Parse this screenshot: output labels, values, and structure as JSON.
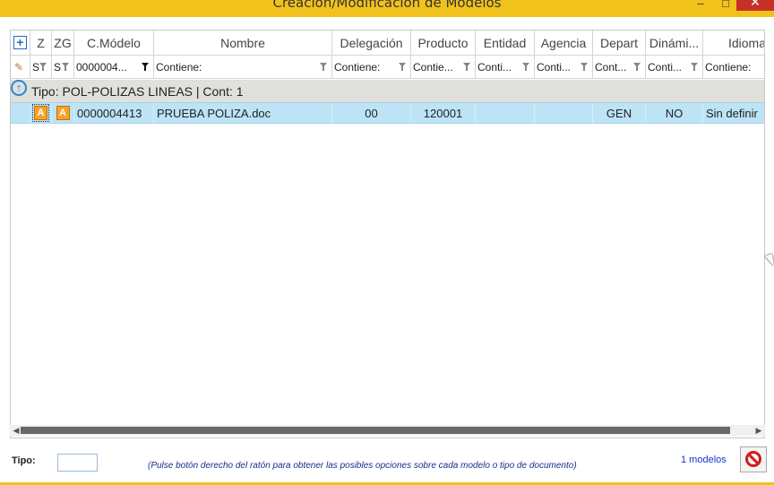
{
  "window": {
    "title": "Creación/Modificación de Modelos",
    "minimize": "–",
    "maximize": "□",
    "close": "✕"
  },
  "grid": {
    "columns": [
      {
        "key": "add",
        "label": "+"
      },
      {
        "key": "z",
        "label": "Z"
      },
      {
        "key": "zg",
        "label": "ZG"
      },
      {
        "key": "cmodelo",
        "label": "C.Módelo"
      },
      {
        "key": "nombre",
        "label": "Nombre"
      },
      {
        "key": "delegacion",
        "label": "Delegación"
      },
      {
        "key": "producto",
        "label": "Producto"
      },
      {
        "key": "entidad",
        "label": "Entidad"
      },
      {
        "key": "agencia",
        "label": "Agencia"
      },
      {
        "key": "depart",
        "label": "Depart"
      },
      {
        "key": "dinamico",
        "label": "Dinámi..."
      },
      {
        "key": "idioma",
        "label": "Idioma"
      }
    ],
    "filters": {
      "z": "S",
      "zg": "S",
      "cmodelo": "0000004...",
      "nombre": "Contiene:",
      "delegacion": "Contiene:",
      "producto": "Contie...",
      "entidad": "Conti...",
      "agencia": "Conti...",
      "depart": "Cont...",
      "dinamico": "Conti...",
      "idioma": "Contiene:"
    },
    "group": {
      "label": "Tipo: POL-POLIZAS LINEAS | Cont: 1"
    },
    "rows": [
      {
        "z_icon": "A",
        "zg_icon": "A",
        "cmodelo": "0000004413",
        "nombre": "PRUEBA POLIZA.doc",
        "delegacion": "00",
        "producto": "120001",
        "entidad": "",
        "agencia": "",
        "depart": "GEN",
        "dinamico": "NO",
        "idioma": "Sin definir"
      }
    ]
  },
  "footer": {
    "tipo_label": "Tipo:",
    "tipo_value": "",
    "hint": "(Pulse botón derecho del ratón para obtener las posibles opciones sobre cada modelo o tipo de documento)",
    "count": "1 modelos"
  },
  "scrollbar": {
    "left_arrow": "◀",
    "right_arrow": "▶"
  },
  "colors": {
    "titlebar": "#f2c21c",
    "selected_row": "#bde3f6",
    "group_row": "#e0e0dc",
    "accent": "#1d6fc4"
  }
}
